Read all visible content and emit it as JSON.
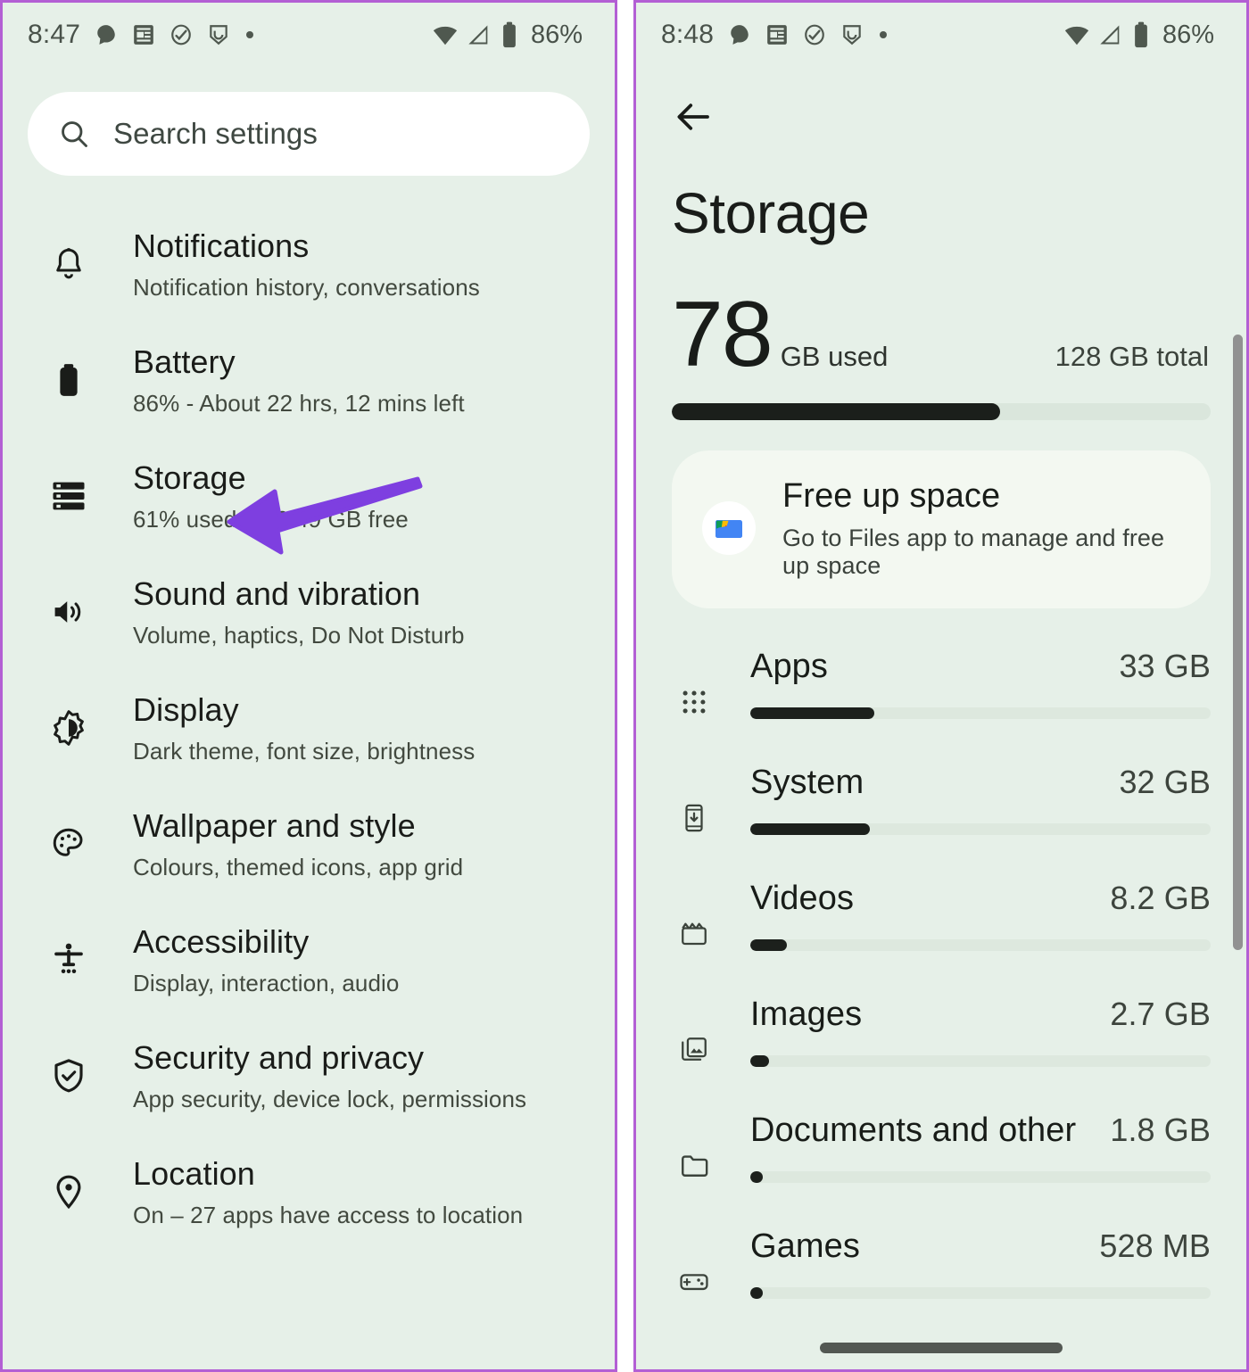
{
  "theme": {
    "background": "#e6f0e8",
    "panel_border": "#b35fd4",
    "accent_arrow": "#7e3fe0",
    "text_primary": "#191c19",
    "text_secondary": "#3d443d",
    "bar_fill": "#1b1f1b",
    "bar_track": "#dae6dc",
    "card_bg": "#f3f8f1"
  },
  "left_panel": {
    "status_bar": {
      "time": "8:47",
      "battery_percent": "86%",
      "left_icons": [
        "chat-bubble-icon",
        "news-card-icon",
        "activity-icon",
        "shield-badge-icon",
        "dot-icon"
      ],
      "right_icons": [
        "wifi-icon",
        "cellular-signal-icon",
        "battery-icon"
      ]
    },
    "search": {
      "placeholder": "Search settings",
      "icon": "search-icon"
    },
    "items": [
      {
        "icon": "bell-icon",
        "title": "Notifications",
        "subtitle": "Notification history, conversations"
      },
      {
        "icon": "battery-icon",
        "title": "Battery",
        "subtitle": "86% - About 22 hrs, 12 mins left"
      },
      {
        "icon": "storage-icon",
        "title": "Storage",
        "subtitle": "61% used – 50.49 GB free"
      },
      {
        "icon": "volume-icon",
        "title": "Sound and vibration",
        "subtitle": "Volume, haptics, Do Not Disturb"
      },
      {
        "icon": "brightness-icon",
        "title": "Display",
        "subtitle": "Dark theme, font size, brightness"
      },
      {
        "icon": "palette-icon",
        "title": "Wallpaper and style",
        "subtitle": "Colours, themed icons, app grid"
      },
      {
        "icon": "accessibility-icon",
        "title": "Accessibility",
        "subtitle": "Display, interaction, audio"
      },
      {
        "icon": "shield-check-icon",
        "title": "Security and privacy",
        "subtitle": "App security, device lock, permissions"
      },
      {
        "icon": "location-pin-icon",
        "title": "Location",
        "subtitle": "On – 27 apps have access to location"
      }
    ],
    "annotation": {
      "type": "arrow",
      "points_to": "Storage",
      "color": "#7e3fe0"
    }
  },
  "right_panel": {
    "status_bar": {
      "time": "8:48",
      "battery_percent": "86%",
      "left_icons": [
        "chat-bubble-icon",
        "news-card-icon",
        "activity-icon",
        "shield-badge-icon",
        "dot-icon"
      ],
      "right_icons": [
        "wifi-icon",
        "cellular-signal-icon",
        "battery-icon"
      ]
    },
    "back_icon": "back-arrow-icon",
    "title": "Storage",
    "usage": {
      "used_number": "78",
      "used_unit": "GB used",
      "total": "128 GB total",
      "used_percent": 61
    },
    "promo_card": {
      "icon": "files-app-icon",
      "title": "Free up space",
      "subtitle": "Go to Files app to manage and free up space"
    },
    "categories": [
      {
        "icon": "apps-grid-icon",
        "name": "Apps",
        "size": "33 GB",
        "percent": 27
      },
      {
        "icon": "system-phone-icon",
        "name": "System",
        "size": "32 GB",
        "percent": 26
      },
      {
        "icon": "videos-clapper-icon",
        "name": "Videos",
        "size": "8.2 GB",
        "percent": 8
      },
      {
        "icon": "images-icon",
        "name": "Images",
        "size": "2.7 GB",
        "percent": 4
      },
      {
        "icon": "folder-icon",
        "name": "Documents and other",
        "size": "1.8 GB",
        "percent": 2.5
      },
      {
        "icon": "gamepad-icon",
        "name": "Games",
        "size": "528 MB",
        "percent": 1
      }
    ],
    "scrollbar": "vertical-scrollbar",
    "home_indicator": "home-indicator"
  },
  "chart_data": {
    "type": "bar",
    "title": "Storage",
    "categories": [
      "Apps",
      "System",
      "Videos",
      "Images",
      "Documents and other",
      "Games"
    ],
    "values": [
      33,
      32,
      8.2,
      2.7,
      1.8,
      0.528
    ],
    "value_labels": [
      "33 GB",
      "32 GB",
      "8.2 GB",
      "2.7 GB",
      "1.8 GB",
      "528 MB"
    ],
    "unit": "GB",
    "total": 128,
    "used": 78,
    "used_percent": 61,
    "xlabel": "",
    "ylabel": "",
    "ylim": [
      0,
      128
    ]
  }
}
